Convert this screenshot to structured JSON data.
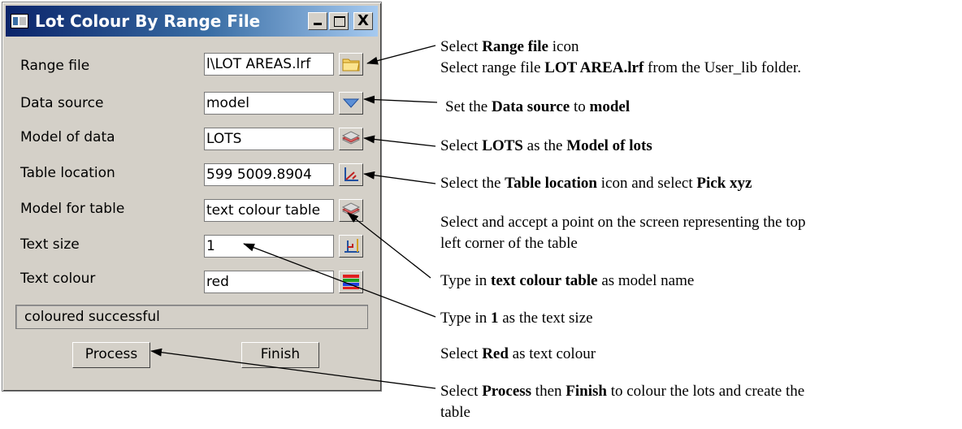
{
  "window": {
    "title": "Lot Colour By Range File",
    "controls": {
      "minimize": "_",
      "maximize": "□",
      "close": "X"
    }
  },
  "form": {
    "rows": [
      {
        "label": "Range file",
        "value": "l\\LOT AREAS.lrf",
        "icon": "folder-icon"
      },
      {
        "label": "Data source",
        "value": "model",
        "icon": "dropdown-arrow-icon"
      },
      {
        "label": "Model of data",
        "value": "LOTS",
        "icon": "model-layers-icon"
      },
      {
        "label": "Table location",
        "value": "599 5009.8904",
        "icon": "pick-xyz-icon"
      },
      {
        "label": "Model for table",
        "value": "text colour table",
        "icon": "model-layers-icon"
      },
      {
        "label": "Text size",
        "value": "1",
        "icon": "text-size-icon"
      },
      {
        "label": "Text colour",
        "value": "red",
        "icon": "colour-palette-icon"
      }
    ],
    "status": "coloured successful",
    "buttons": {
      "process": "Process",
      "finish": "Finish"
    }
  },
  "annotations": {
    "a1": {
      "p1": "Select ",
      "b1": "Range file",
      "p2": " icon"
    },
    "a2": {
      "p1": "Select range file ",
      "b1": "LOT AREA.lrf",
      "p2": " from the User_lib folder."
    },
    "a3": {
      "p1": "Set the ",
      "b1": "Data source",
      "p2": " to ",
      "b2": "model"
    },
    "a4": {
      "p1": "Select ",
      "b1": "LOTS",
      "p2": " as the ",
      "b2": "Model of lots"
    },
    "a5": {
      "p1": "Select the ",
      "b1": "Table location",
      "p2": " icon and select ",
      "b2": "Pick xyz"
    },
    "a6": {
      "line1": "Select and accept a point on the screen representing the top",
      "line2": "left corner of the table"
    },
    "a7": {
      "p1": "Type in ",
      "b1": "text colour table",
      "p2": " as model name"
    },
    "a8": {
      "p1": "Type in ",
      "b1": "1",
      "p2": " as the text size"
    },
    "a9": {
      "p1": "Select ",
      "b1": "Red",
      "p2": " as text colour"
    },
    "a10": {
      "p1": "Select ",
      "b1": "Process",
      "p2": " then ",
      "b2": "Finish",
      "p3": " to colour the lots and create the",
      "line2": "table"
    }
  }
}
